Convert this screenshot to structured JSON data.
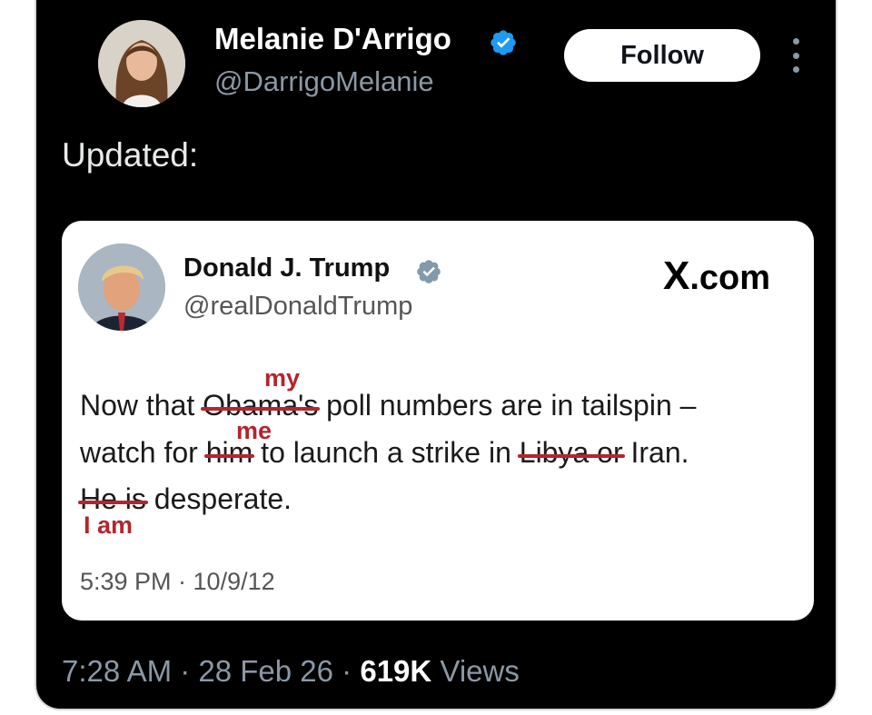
{
  "author": {
    "display_name": "Melanie D'Arrigo",
    "handle": "@DarrigoMelanie",
    "verified_icon": "verified-badge-icon",
    "verified_color": "#1d9bf0"
  },
  "follow_button_label": "Follow",
  "more_icon": "more-vertical-icon",
  "tweet_text": "Updated:",
  "quoted": {
    "display_name": "Donald J. Trump",
    "handle": "@realDonaldTrump",
    "verified_color": "#829aab",
    "source_label": "X.com",
    "line1": {
      "before": "Now that ",
      "struck": "Obama's",
      "after": " poll numbers are in tailspin –",
      "correction": "my"
    },
    "line2": {
      "before": "watch for ",
      "struck1": "him",
      "middle": " to launch a strike in ",
      "struck2": "Libya or",
      "after": " Iran.",
      "correction": "me"
    },
    "line3": {
      "struck": "He is",
      "after": " desperate.",
      "correction": "I am"
    },
    "correction_color": "#b2262d",
    "timestamp": "5:39 PM · 10/9/12"
  },
  "meta": {
    "time_date": "7:28 AM · 28 Feb 26 · ",
    "views_count": "619K",
    "views_label": " Views"
  }
}
